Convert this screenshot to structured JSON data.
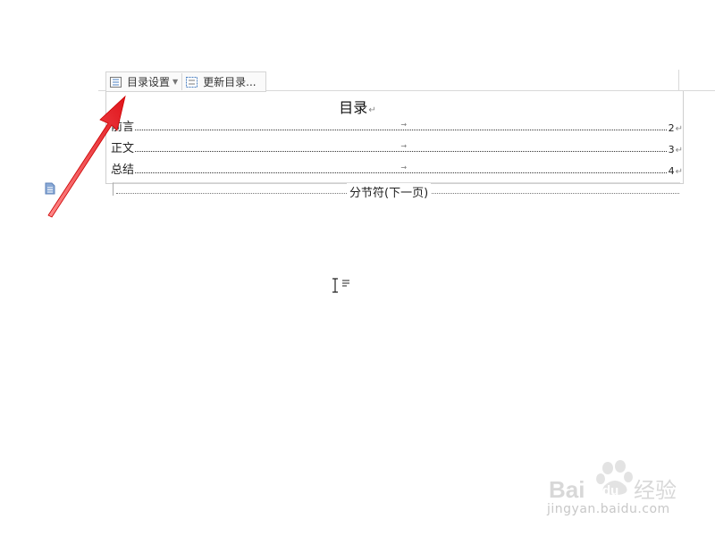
{
  "toolbar": {
    "toc_settings_label": "目录设置",
    "update_toc_label": "更新目录..."
  },
  "toc": {
    "title": "目录",
    "paragraph_mark": "↵",
    "tab_mark": "→",
    "entries": [
      {
        "label": "前言",
        "page": "2"
      },
      {
        "label": "正文",
        "page": "3"
      },
      {
        "label": "总结",
        "page": "4"
      }
    ]
  },
  "section_break": {
    "label": "分节符(下一页)"
  },
  "watermark": {
    "url": "jingyan.baidu.com"
  },
  "colors": {
    "annotation_arrow": "#e0141b",
    "icon_blue": "#4a7fc1"
  },
  "icons": [
    "toc-settings-icon",
    "update-toc-icon",
    "document-icon",
    "text-cursor-icon"
  ]
}
